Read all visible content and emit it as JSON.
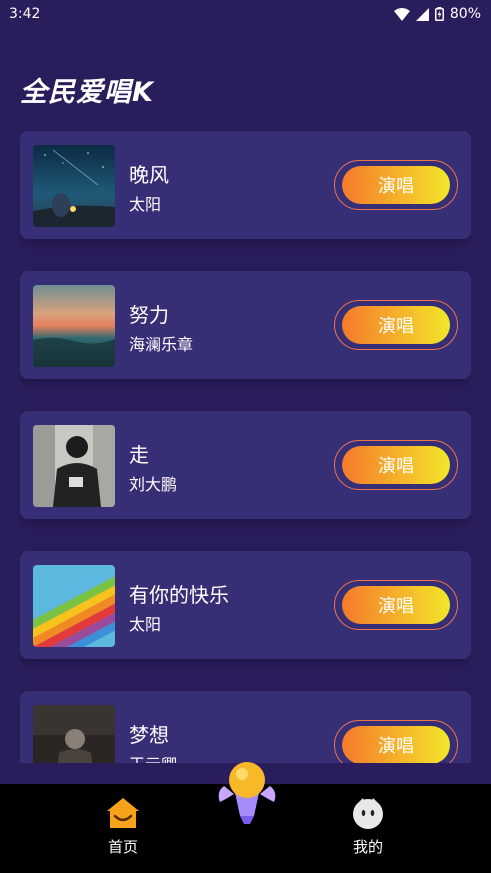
{
  "status": {
    "time": "3:42",
    "battery": "80%"
  },
  "app": {
    "title": "全民爱唱K"
  },
  "songs": [
    {
      "title": "晚风",
      "artist": "太阳",
      "button": "演唱",
      "cover": "night-sky-cover"
    },
    {
      "title": "努力",
      "artist": "海澜乐章",
      "button": "演唱",
      "cover": "sea-sunset-cover"
    },
    {
      "title": "走",
      "artist": "刘大鹏",
      "button": "演唱",
      "cover": "person-photo-cover"
    },
    {
      "title": "有你的快乐",
      "artist": "太阳",
      "button": "演唱",
      "cover": "rainbow-stripes-cover"
    },
    {
      "title": "梦想",
      "artist": "王元卿",
      "button": "演唱",
      "cover": "dark-photo-cover"
    }
  ],
  "nav": {
    "home_label": "首页",
    "mine_label": "我的"
  },
  "colors": {
    "background": "#2a1d5c",
    "card": "#372f76",
    "accent_start": "#f57a2c",
    "accent_end": "#f2e72a"
  }
}
